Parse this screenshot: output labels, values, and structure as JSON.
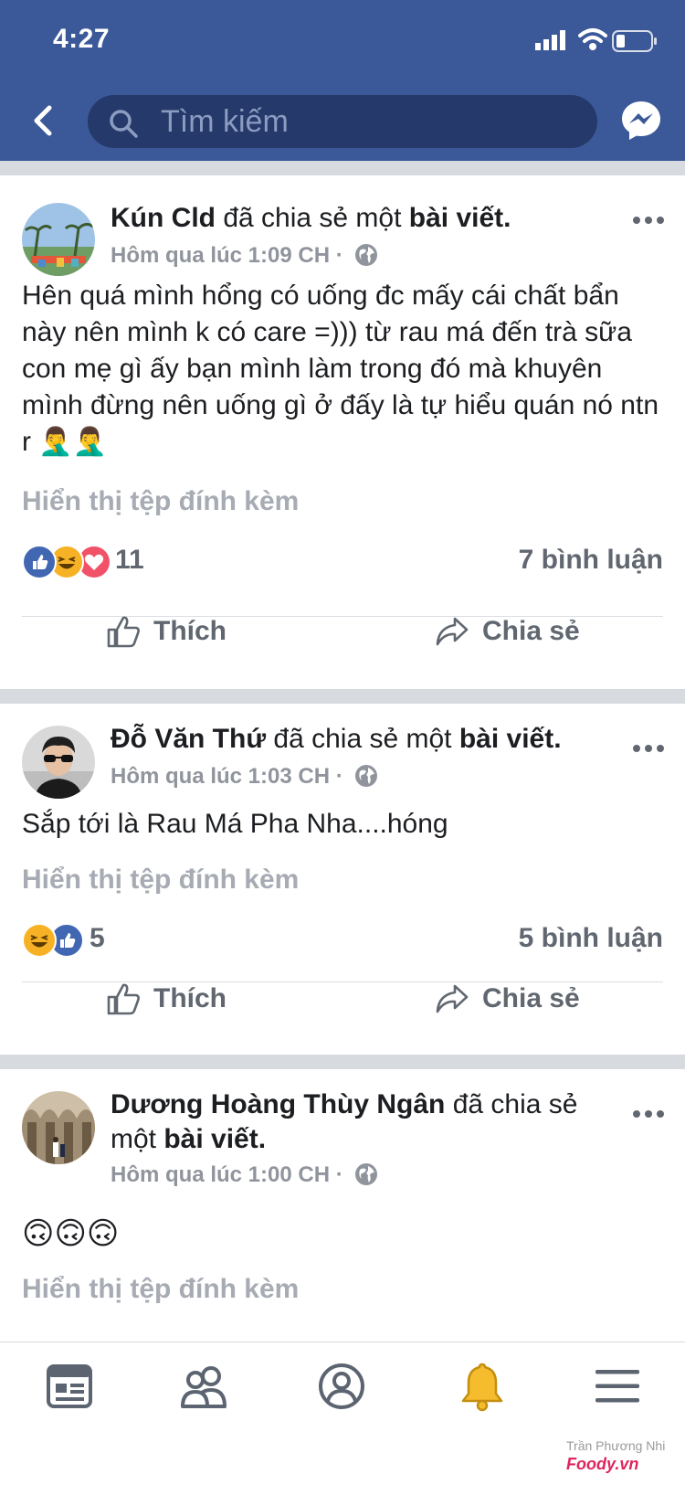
{
  "status": {
    "time": "4:27"
  },
  "search": {
    "placeholder": "Tìm kiếm"
  },
  "posts": [
    {
      "author": "Kún Cld",
      "action_text": " đã chia sẻ một ",
      "object_text": "bài viết.",
      "time": "Hôm qua lúc 1:09 CH",
      "separator": "·",
      "text": "Hên quá mình hổng có uống đc mấy cái chất bẩn này nên mình k có care =))) từ rau má đến trà sữa con mẹ gì ấy bạn mình làm trong đó mà khuyên mình đừng nên uống gì ở đấy là tự hiểu quán nó ntn r 🤦‍♂️🤦‍♂️",
      "attachment_label": "Hiển thị tệp đính kèm",
      "reaction_count": "11",
      "comments": "7 bình luận",
      "like_label": "Thích",
      "share_label": "Chia sẻ"
    },
    {
      "author": "Đỗ Văn Thứ",
      "action_text": " đã chia sẻ một ",
      "object_text": "bài viết.",
      "time": "Hôm qua lúc 1:03 CH",
      "separator": "·",
      "text": "Sắp tới là Rau Má Pha Nha....hóng",
      "attachment_label": "Hiển thị tệp đính kèm",
      "reaction_count": "5",
      "comments": "5 bình luận",
      "like_label": "Thích",
      "share_label": "Chia sẻ"
    },
    {
      "author": "Dương Hoàng Thùy Ngân",
      "action_text": " đã chia sẻ một ",
      "object_text": "bài viết.",
      "time": "Hôm qua lúc 1:00 CH",
      "separator": "·",
      "text": "🙃🙃🙃",
      "attachment_label": "Hiển thị tệp đính kèm"
    }
  ],
  "watermark": {
    "line1": "Trần Phương Nhi",
    "line2": "Foody.vn"
  },
  "colors": {
    "brand": "#3b5998",
    "like": "#4267b2",
    "love": "#f25268",
    "haha": "#f7b125"
  }
}
